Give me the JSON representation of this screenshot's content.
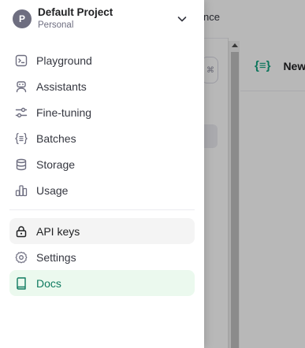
{
  "background": {
    "topnav_fragment": "nce",
    "right_panel_title": "New",
    "right_panel_icon": "braces-icon"
  },
  "project": {
    "avatar_letter": "P",
    "name": "Default Project",
    "subtitle": "Personal"
  },
  "nav_primary": [
    {
      "label": "Playground",
      "icon": "terminal-icon"
    },
    {
      "label": "Assistants",
      "icon": "robot-icon"
    },
    {
      "label": "Fine-tuning",
      "icon": "sliders-icon"
    },
    {
      "label": "Batches",
      "icon": "braces-list-icon"
    },
    {
      "label": "Storage",
      "icon": "database-icon"
    },
    {
      "label": "Usage",
      "icon": "bar-chart-icon"
    }
  ],
  "nav_secondary": [
    {
      "label": "API keys",
      "icon": "lock-icon"
    },
    {
      "label": "Settings",
      "icon": "gear-icon"
    },
    {
      "label": "Docs",
      "icon": "book-icon"
    }
  ],
  "colors": {
    "accent": "#10a37f",
    "active_bg": "#ebf9ee",
    "hover_bg": "#f4f4f4"
  }
}
